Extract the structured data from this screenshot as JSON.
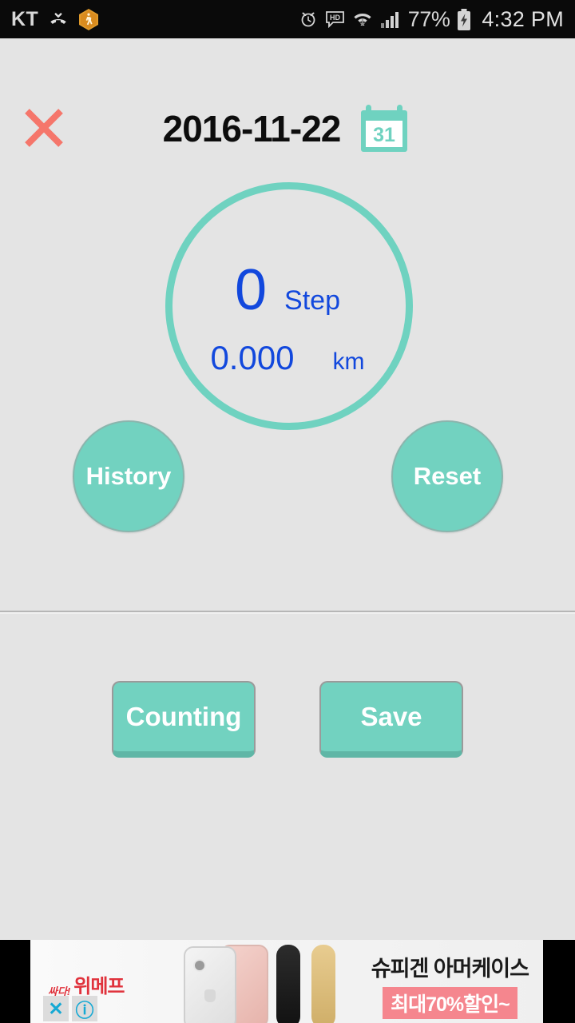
{
  "statusbar": {
    "carrier": "KT",
    "icons_left": [
      "call-muted-icon",
      "pedometer-hexagon-icon"
    ],
    "icons_right": [
      "alarm-icon",
      "hd-voice-icon",
      "wifi-icon",
      "signal-bars-icon",
      "battery-charging-icon"
    ],
    "battery_percent": "77%",
    "time": "4:32 PM"
  },
  "header": {
    "close_label": "close-icon",
    "date": "2016-11-22",
    "calendar_day": "31"
  },
  "counter": {
    "steps": "0",
    "steps_unit": "Step",
    "distance": "0.000",
    "distance_unit": "km"
  },
  "actions": {
    "history_label": "History",
    "reset_label": "Reset"
  },
  "controls": {
    "counting_label": "Counting",
    "save_label": "Save"
  },
  "ad": {
    "logo_small": "싸다!",
    "logo_big": "위메프",
    "close_label": "✕",
    "info_label": "ⓘ",
    "headline": "슈피겐 아머케이스",
    "subline": "최대70%할인~"
  },
  "colors": {
    "teal": "#72d2c0",
    "blue": "#1248dd",
    "salmon": "#f5766b",
    "background": "#e4e4e4",
    "statusbar": "#0a0a0a"
  }
}
